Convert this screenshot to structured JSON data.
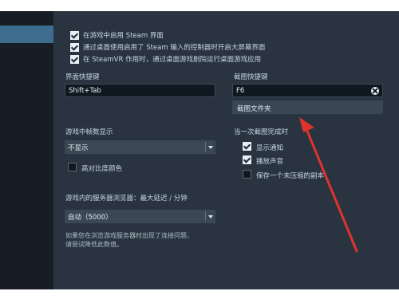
{
  "game_overlay": {
    "checkboxes": [
      {
        "label": "在游戏中启用 Steam 界面",
        "checked": true
      },
      {
        "label": "通过桌面使用启用了 Steam 输入的控制器时开启大屏幕界面",
        "checked": true
      },
      {
        "label": "在 SteamVR 作用时，通过桌面游戏剧院运行桌面游戏应用",
        "checked": true
      }
    ],
    "shortcut_label": "界面快捷键",
    "shortcut_value": "Shift+Tab"
  },
  "screenshot": {
    "shortcut_label": "截图快捷键",
    "shortcut_value": "F6",
    "folder_button": "截图文件夹",
    "on_complete_label": "当一次截图完成时",
    "options": [
      {
        "label": "显示通知",
        "checked": true
      },
      {
        "label": "播放声音",
        "checked": true
      },
      {
        "label": "保存一个未压缩的副本",
        "checked": false
      }
    ]
  },
  "fps": {
    "label": "游戏中帧数显示",
    "value": "不显示",
    "high_contrast_label": "高对比度颜色",
    "high_contrast_checked": false
  },
  "server_browser": {
    "label": "游戏内的服务器浏览器：最大延迟 / 分钟",
    "value": "自动（5000）",
    "hint_lines": [
      "如果您在浏览游戏服务器时出现了连接问题，",
      "请尝试降低此数值。"
    ]
  },
  "colors": {
    "annotation_arrow": "#e0332b",
    "panel": "#2a3440"
  }
}
